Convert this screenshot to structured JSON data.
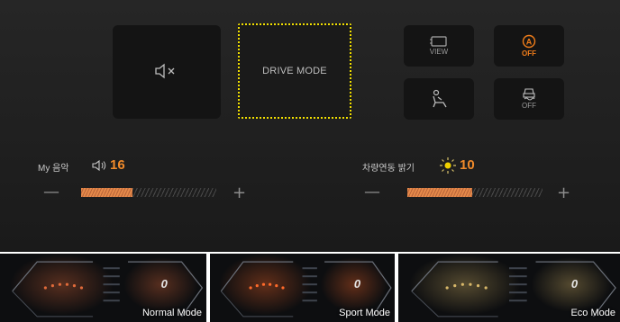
{
  "controls": {
    "mute_tile": {
      "icon": "speaker-mute-icon"
    },
    "drive_mode": {
      "label": "DRIVE MODE"
    },
    "view_tile": {
      "icon": "camera-view-icon",
      "label": "VIEW"
    },
    "auto_hold_tile": {
      "icon": "auto-hold-icon",
      "label": "OFF"
    },
    "seat_tile": {
      "icon": "seat-icon"
    },
    "esc_tile": {
      "icon": "esc-off-icon",
      "label": "OFF"
    }
  },
  "music_volume": {
    "label": "My 음악",
    "icon": "speaker-icon",
    "value": "16",
    "level": 0.38
  },
  "brightness": {
    "label": "차량연동 밝기",
    "icon": "sun-icon",
    "value": "10",
    "level": 0.48
  },
  "modes": [
    {
      "label": "Normal Mode",
      "accent": "#e06a3a"
    },
    {
      "label": "Sport Mode",
      "accent": "#ff6a2a"
    },
    {
      "label": "Eco Mode",
      "accent": "#d8b86a"
    }
  ],
  "colors": {
    "accent": "#f08a2a",
    "highlight": "#f2e000",
    "panel_bg": "#222222"
  }
}
